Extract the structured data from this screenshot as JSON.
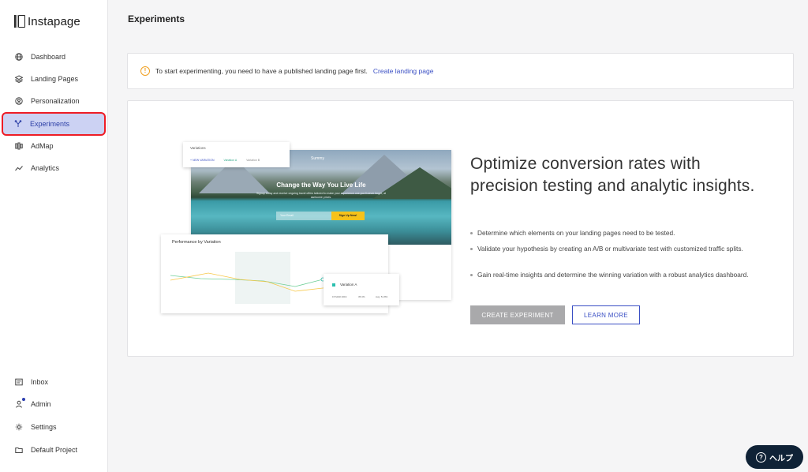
{
  "app": {
    "logo": "Instapage"
  },
  "sidebar": {
    "items": [
      {
        "label": "Dashboard",
        "icon": "globe-icon"
      },
      {
        "label": "Landing Pages",
        "icon": "layers-icon"
      },
      {
        "label": "Personalization",
        "icon": "user-circle-icon"
      },
      {
        "label": "Experiments",
        "icon": "branch-icon",
        "active": true
      },
      {
        "label": "AdMap",
        "icon": "admap-icon"
      },
      {
        "label": "Analytics",
        "icon": "trend-icon"
      }
    ],
    "bottom_items": [
      {
        "label": "Inbox",
        "icon": "inbox-icon"
      },
      {
        "label": "Admin",
        "icon": "user-icon",
        "notification": true
      },
      {
        "label": "Settings",
        "icon": "gear-icon"
      },
      {
        "label": "Default Project",
        "icon": "folder-icon"
      }
    ]
  },
  "page": {
    "title": "Experiments"
  },
  "alert": {
    "text": "To start experimenting, you need to have a published landing page first.",
    "link": "Create landing page"
  },
  "hero": {
    "headline": "Optimize conversion rates with precision testing and analytic insights.",
    "bullets": [
      "Determine which elements on your landing pages need to be tested.",
      "Validate your hypothesis by creating an A/B or multivariate test with customized traffic splits.",
      "Gain real-time insights and determine the winning variation with a robust analytics dashboard."
    ],
    "primary_button": "CREATE EXPERIMENT",
    "secondary_button": "LEARN MORE"
  },
  "illustration": {
    "variations_title": "Variations",
    "new_variation": "+ NEW VARIATION",
    "variation_a": "Variation A",
    "variation_b": "Variation B",
    "lp_logo": "Summy",
    "lp_headline": "Change the Way You Live Life",
    "lp_subtext": "Signup today and receive ongoing travel offers tailored to make your experience one you'll never forget, at awesome prices.",
    "lp_input_placeholder": "Your Email",
    "lp_button": "Sign Up Now!",
    "performance_title": "Performance by Variation",
    "tooltip_label": "Variation A",
    "tooltip_date": "15 MAR 2019",
    "tooltip_value_1": "35.3%",
    "tooltip_value_2": "Avg. 51.8%"
  },
  "help": {
    "label": "ヘルプ"
  },
  "colors": {
    "accent": "#3a4fc4",
    "active_bg": "#ccd2f3",
    "highlight_border": "#ee1c25",
    "warning": "#f0a021",
    "help_bg": "#0f2236"
  }
}
